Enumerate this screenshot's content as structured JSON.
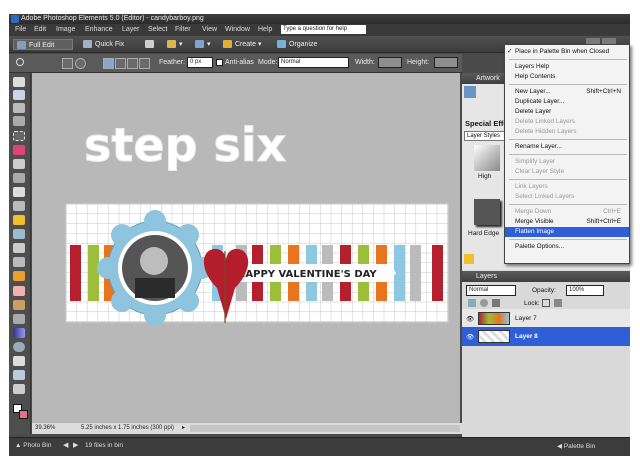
{
  "window": {
    "title": "Adobe Photoshop Elements 5.0 (Editor) - candybarboy.png"
  },
  "menubar": {
    "items": [
      "File",
      "Edit",
      "Image",
      "Enhance",
      "Layer",
      "Select",
      "Filter",
      "View",
      "Window",
      "Help"
    ],
    "help_placeholder": "Type a question for help"
  },
  "shortcuts": {
    "full_edit": "Full Edit",
    "quick_fix": "Quick Fix",
    "create": "Create",
    "organize": "Organize"
  },
  "options": {
    "feather_label": "Feather:",
    "feather_value": "0 px",
    "antialias_label": "Anti-alias",
    "mode_label": "Mode:",
    "mode_value": "Normal",
    "width_label": "Width:",
    "height_label": "Height:"
  },
  "canvas": {
    "step_text": "step six",
    "banner_text": "HAPPY VALENTINE'S DAY"
  },
  "status": {
    "zoom": "39.36%",
    "doc_size": "5.25 inches x 1.75 inches (300 ppi)"
  },
  "palettes": {
    "artwork_title": "Artwork",
    "special_effects": "Special Effects",
    "layer_styles": "Layer Styles",
    "style_high": "High",
    "style_hard_edge": "Hard Edge",
    "layers_title": "Layers",
    "blend_mode": "Normal",
    "opacity_label": "Opacity:",
    "opacity_value": "100%",
    "lock_label": "Lock:"
  },
  "layers": [
    {
      "name": "Layer 7",
      "selected": false
    },
    {
      "name": "Layer 8",
      "selected": true
    }
  ],
  "context_menu": {
    "items": [
      {
        "label": "Place in Palette Bin when Closed",
        "checked": true,
        "enabled": true,
        "shortcut": ""
      },
      {
        "sep": true
      },
      {
        "label": "Layers Help",
        "enabled": true,
        "shortcut": ""
      },
      {
        "label": "Help Contents",
        "enabled": true,
        "shortcut": ""
      },
      {
        "sep": true
      },
      {
        "label": "New Layer...",
        "enabled": true,
        "shortcut": "Shift+Ctrl+N"
      },
      {
        "label": "Duplicate Layer...",
        "enabled": true,
        "shortcut": ""
      },
      {
        "label": "Delete Layer",
        "enabled": true,
        "shortcut": ""
      },
      {
        "label": "Delete Linked Layers",
        "enabled": false,
        "shortcut": ""
      },
      {
        "label": "Delete Hidden Layers",
        "enabled": false,
        "shortcut": ""
      },
      {
        "sep": true
      },
      {
        "label": "Rename Layer...",
        "enabled": true,
        "shortcut": ""
      },
      {
        "sep": true
      },
      {
        "label": "Simplify Layer",
        "enabled": false,
        "shortcut": ""
      },
      {
        "label": "Clear Layer Style",
        "enabled": false,
        "shortcut": ""
      },
      {
        "sep": true
      },
      {
        "label": "Link Layers",
        "enabled": false,
        "shortcut": ""
      },
      {
        "label": "Select Linked Layers",
        "enabled": false,
        "shortcut": ""
      },
      {
        "sep": true
      },
      {
        "label": "Merge Down",
        "enabled": false,
        "shortcut": "Ctrl+E"
      },
      {
        "label": "Merge Visible",
        "enabled": true,
        "shortcut": "Shift+Ctrl+E"
      },
      {
        "label": "Flatten Image",
        "enabled": true,
        "selected": true,
        "shortcut": ""
      },
      {
        "sep": true
      },
      {
        "label": "Palette Options...",
        "enabled": true,
        "shortcut": ""
      }
    ]
  },
  "bottombar": {
    "photo_bin": "Photo Bin",
    "files_in_bin": "19 files in bin",
    "palette_bin": "Palette Bin"
  },
  "colors": {
    "accent": "#2f5fd6",
    "stripe_red": "#b5202f",
    "stripe_green": "#9cbe3a",
    "stripe_orange": "#e8741e",
    "stripe_blue": "#8ec7e1",
    "heart": "#b41e2c"
  }
}
